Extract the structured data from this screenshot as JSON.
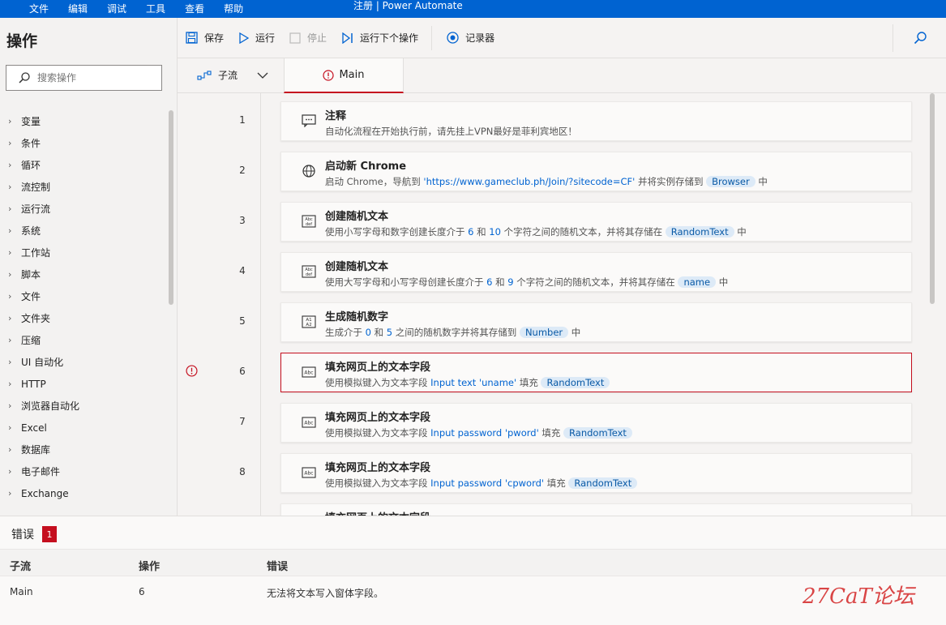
{
  "menubar": {
    "items": [
      "文件",
      "编辑",
      "调试",
      "工具",
      "查看",
      "帮助"
    ],
    "title": "注册 | Power Automate"
  },
  "left": {
    "title": "操作",
    "search_placeholder": "搜索操作",
    "actions": [
      "变量",
      "条件",
      "循环",
      "流控制",
      "运行流",
      "系统",
      "工作站",
      "脚本",
      "文件",
      "文件夹",
      "压缩",
      "UI 自动化",
      "HTTP",
      "浏览器自动化",
      "Excel",
      "数据库",
      "电子邮件",
      "Exchange"
    ]
  },
  "toolbar": {
    "save": "保存",
    "run": "运行",
    "stop": "停止",
    "run_next": "运行下个操作",
    "recorder": "记录器"
  },
  "tabs": {
    "subflow": "子流",
    "main": "Main"
  },
  "steps": [
    {
      "num": "1",
      "title": "注释",
      "desc": "自动化流程在开始执行前，请先挂上VPN最好是菲利宾地区！"
    },
    {
      "num": "2",
      "title": "启动新 Chrome",
      "desc_a": "启动 Chrome，导航到 ",
      "url": "'https://www.gameclub.ph/Join/?sitecode=CF'",
      "desc_b": " 并将实例存储到 ",
      "var": "Browser",
      "desc_c": " 中"
    },
    {
      "num": "3",
      "title": "创建随机文本",
      "desc_a": "使用小写字母和数字创建长度介于 ",
      "n1": "6",
      "desc_b": " 和 ",
      "n2": "10",
      "desc_c": " 个字符之间的随机文本，并将其存储在 ",
      "var": "RandomText",
      "desc_d": " 中"
    },
    {
      "num": "4",
      "title": "创建随机文本",
      "desc_a": "使用大写字母和小写字母创建长度介于 ",
      "n1": "6",
      "desc_b": " 和 ",
      "n2": "9",
      "desc_c": " 个字符之间的随机文本，并将其存储在 ",
      "var": "name",
      "desc_d": " 中"
    },
    {
      "num": "5",
      "title": "生成随机数字",
      "desc_a": "生成介于 ",
      "n1": "0",
      "desc_b": " 和 ",
      "n2": "5",
      "desc_c": " 之间的随机数字并将其存储到 ",
      "var": "Number",
      "desc_d": " 中"
    },
    {
      "num": "6",
      "title": "填充网页上的文本字段",
      "desc_a": "使用模拟键入为文本字段 ",
      "field": "Input text 'uname'",
      "desc_b": " 填充 ",
      "var": "RandomText"
    },
    {
      "num": "7",
      "title": "填充网页上的文本字段",
      "desc_a": "使用模拟键入为文本字段 ",
      "field": "Input password 'pword'",
      "desc_b": " 填充 ",
      "var": "RandomText"
    },
    {
      "num": "8",
      "title": "填充网页上的文本字段",
      "desc_a": "使用模拟键入为文本字段 ",
      "field": "Input password 'cpword'",
      "desc_b": " 填充 ",
      "var": "RandomText"
    },
    {
      "title": "填充网页上的文本字段"
    }
  ],
  "errors": {
    "title": "错误",
    "count": "1",
    "columns": [
      "子流",
      "操作",
      "错误"
    ],
    "row": {
      "subflow": "Main",
      "action": "6",
      "error": "无法将文本写入窗体字段。"
    }
  },
  "watermark": "27CaT论坛"
}
